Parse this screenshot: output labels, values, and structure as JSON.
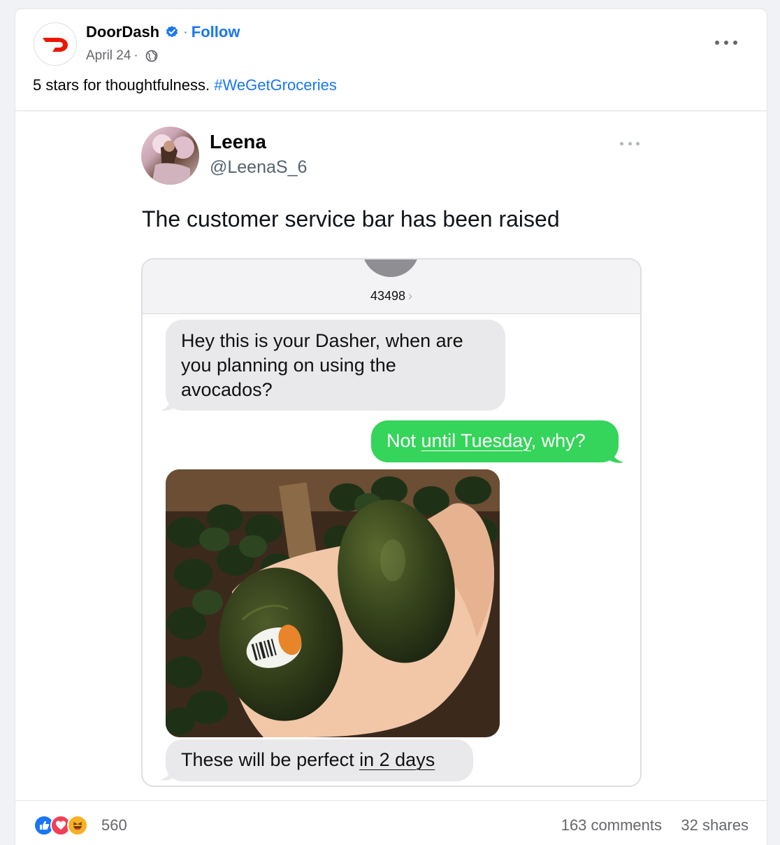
{
  "post": {
    "author": "DoorDash",
    "separator": "·",
    "follow_label": "Follow",
    "date": "April 24",
    "date_separator": "·",
    "audience_icon": "globe-icon",
    "more_icon": "more-options-icon",
    "caption_text": "5 stars for thoughtfulness. ",
    "caption_hashtag": "#WeGetGroceries",
    "brand_color": "#eb1700",
    "link_color": "#1877f2"
  },
  "tweet": {
    "name": "Leena",
    "handle": "@LeenaS_6",
    "text": "The customer service bar has been raised",
    "more_icon": "more-options-icon"
  },
  "sms": {
    "sender_number": "43498",
    "chevron": "›",
    "msg1": "Hey this is your Dasher, when are you planning on using the avocados?",
    "msg2_pre": "Not ",
    "msg2_underlined": "until Tuesday",
    "msg2_post": ", why?",
    "msg3_pre": "These will be perfect ",
    "msg3_underlined": "in 2 days",
    "incoming_color": "#e9e9eb",
    "outgoing_color": "#35d45a"
  },
  "footer": {
    "reaction_icons": [
      "like-icon",
      "love-icon",
      "haha-icon"
    ],
    "reaction_count": "560",
    "comments": "163 comments",
    "shares": "32 shares"
  }
}
